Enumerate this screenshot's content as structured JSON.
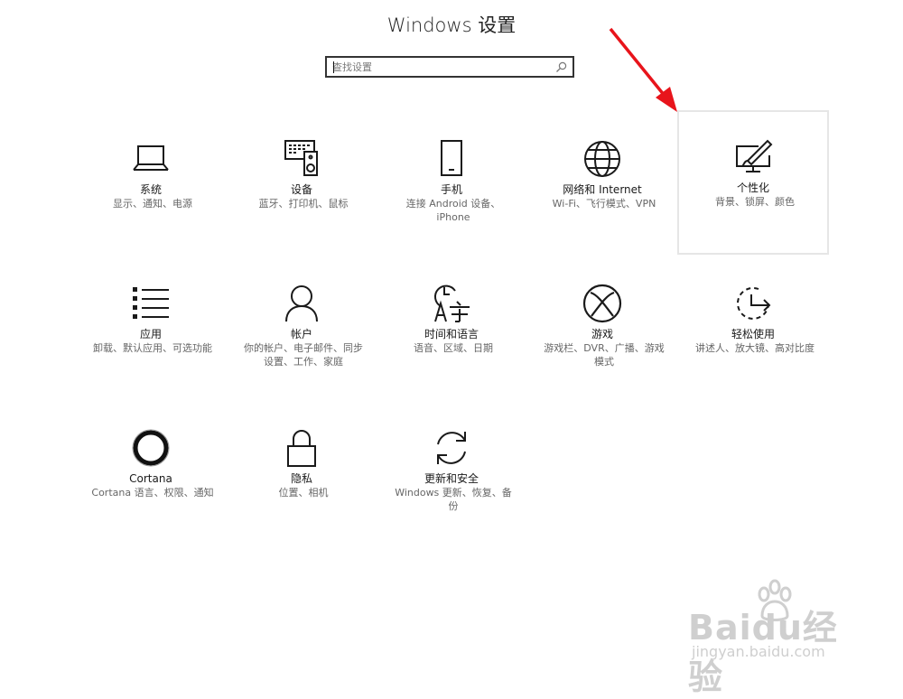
{
  "window": {
    "title": "Windows 设置"
  },
  "search": {
    "placeholder": "查找设置",
    "icon": "search-icon"
  },
  "tiles": [
    {
      "name": "系统",
      "desc": "显示、通知、电源",
      "icon": "laptop-icon"
    },
    {
      "name": "设备",
      "desc": "蓝牙、打印机、鼠标",
      "icon": "keyboard-speaker-icon"
    },
    {
      "name": "手机",
      "desc": "连接 Android 设备、iPhone",
      "icon": "phone-icon"
    },
    {
      "name": "网络和 Internet",
      "desc": "Wi-Fi、飞行模式、VPN",
      "icon": "globe-icon"
    },
    {
      "name": "个性化",
      "desc": "背景、锁屏、颜色",
      "icon": "paint-monitor-icon",
      "selected": true
    },
    {
      "name": "应用",
      "desc": "卸载、默认应用、可选功能",
      "icon": "app-list-icon"
    },
    {
      "name": "帐户",
      "desc": "你的帐户、电子邮件、同步设置、工作、家庭",
      "icon": "person-icon"
    },
    {
      "name": "时间和语言",
      "desc": "语音、区域、日期",
      "icon": "time-language-icon"
    },
    {
      "name": "游戏",
      "desc": "游戏栏、DVR、广播、游戏模式",
      "icon": "xbox-icon"
    },
    {
      "name": "轻松使用",
      "desc": "讲述人、放大镜、高对比度",
      "icon": "ease-of-access-icon"
    },
    {
      "name": "Cortana",
      "desc": "Cortana 语言、权限、通知",
      "icon": "cortana-ring-icon"
    },
    {
      "name": "隐私",
      "desc": "位置、相机",
      "icon": "lock-icon"
    },
    {
      "name": "更新和安全",
      "desc": "Windows 更新、恢复、备份",
      "icon": "sync-icon"
    }
  ],
  "annotation": {
    "color": "#e8141b"
  },
  "watermark": {
    "brand": "Baidu经验",
    "url": "jingyan.baidu.com"
  }
}
